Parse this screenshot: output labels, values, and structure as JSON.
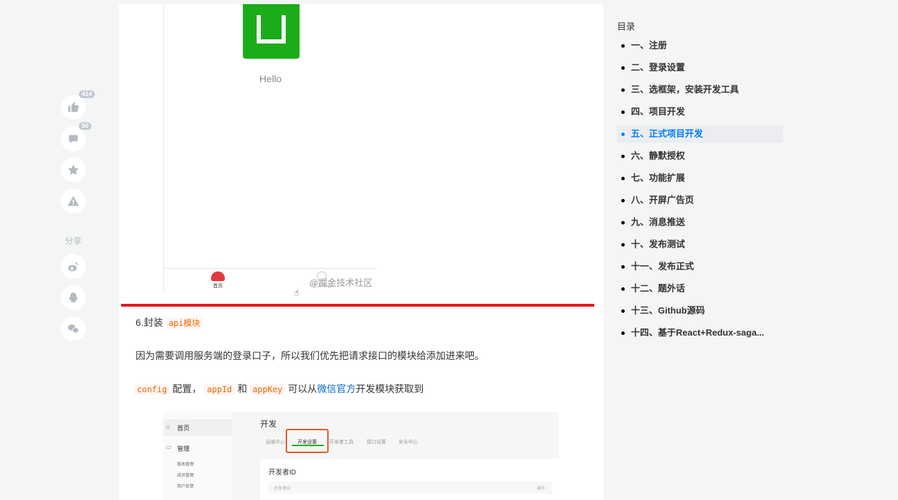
{
  "actions": {
    "like_count": "414",
    "comment_count": "56",
    "share_label": "分享",
    "icons": [
      "thumbs-up-icon",
      "comment-icon",
      "star-icon",
      "report-icon",
      "weibo-icon",
      "qq-icon",
      "wechat-icon"
    ]
  },
  "phone": {
    "greeting": "Hello",
    "tab_home": "首页",
    "tab_me": "个人中心",
    "watermark": "@掘金技术社区",
    "logo_color": "#1aad19"
  },
  "article": {
    "step_prefix": "6.封装 ",
    "step_code": "api模块",
    "para1": "因为需要调用服务端的登录口子，所以我们优先把请求接口的模块给添加进来吧。",
    "para2": {
      "code1": "config",
      "text1": " 配置，",
      "code2": "appId",
      "text2": " 和 ",
      "code3": "appKey",
      "text3": " 可以从",
      "link": "微信官方",
      "text4": "开发模块获取到"
    },
    "accent_red": "#e8161d"
  },
  "console_shot": {
    "side_home": "首页",
    "side_manage": "管理",
    "side_subs": [
      "版本管理",
      "成员管理",
      "用户反馈"
    ],
    "title": "开发",
    "tabs": [
      "运维中心",
      "开发设置",
      "开发者工具",
      "接口设置",
      "安全中心"
    ],
    "panel_title": "开发者ID",
    "row_left": "开发者ID",
    "row_right": "操作"
  },
  "toc": {
    "title": "目录",
    "active_color": "#007fff",
    "items": [
      {
        "label": "一、注册",
        "active": false
      },
      {
        "label": "二、登录设置",
        "active": false
      },
      {
        "label": "三、选框架，安装开发工具",
        "active": false
      },
      {
        "label": "四、项目开发",
        "active": false
      },
      {
        "label": "五、正式项目开发",
        "active": true
      },
      {
        "label": "六、静默授权",
        "active": false
      },
      {
        "label": "七、功能扩展",
        "active": false
      },
      {
        "label": "八、开屏广告页",
        "active": false
      },
      {
        "label": "九、消息推送",
        "active": false
      },
      {
        "label": "十、发布测试",
        "active": false
      },
      {
        "label": "十一、发布正式",
        "active": false
      },
      {
        "label": "十二、题外话",
        "active": false
      },
      {
        "label": "十三、Github源码",
        "active": false
      },
      {
        "label": "十四、基于React+Redux-saga...",
        "active": false
      }
    ]
  }
}
